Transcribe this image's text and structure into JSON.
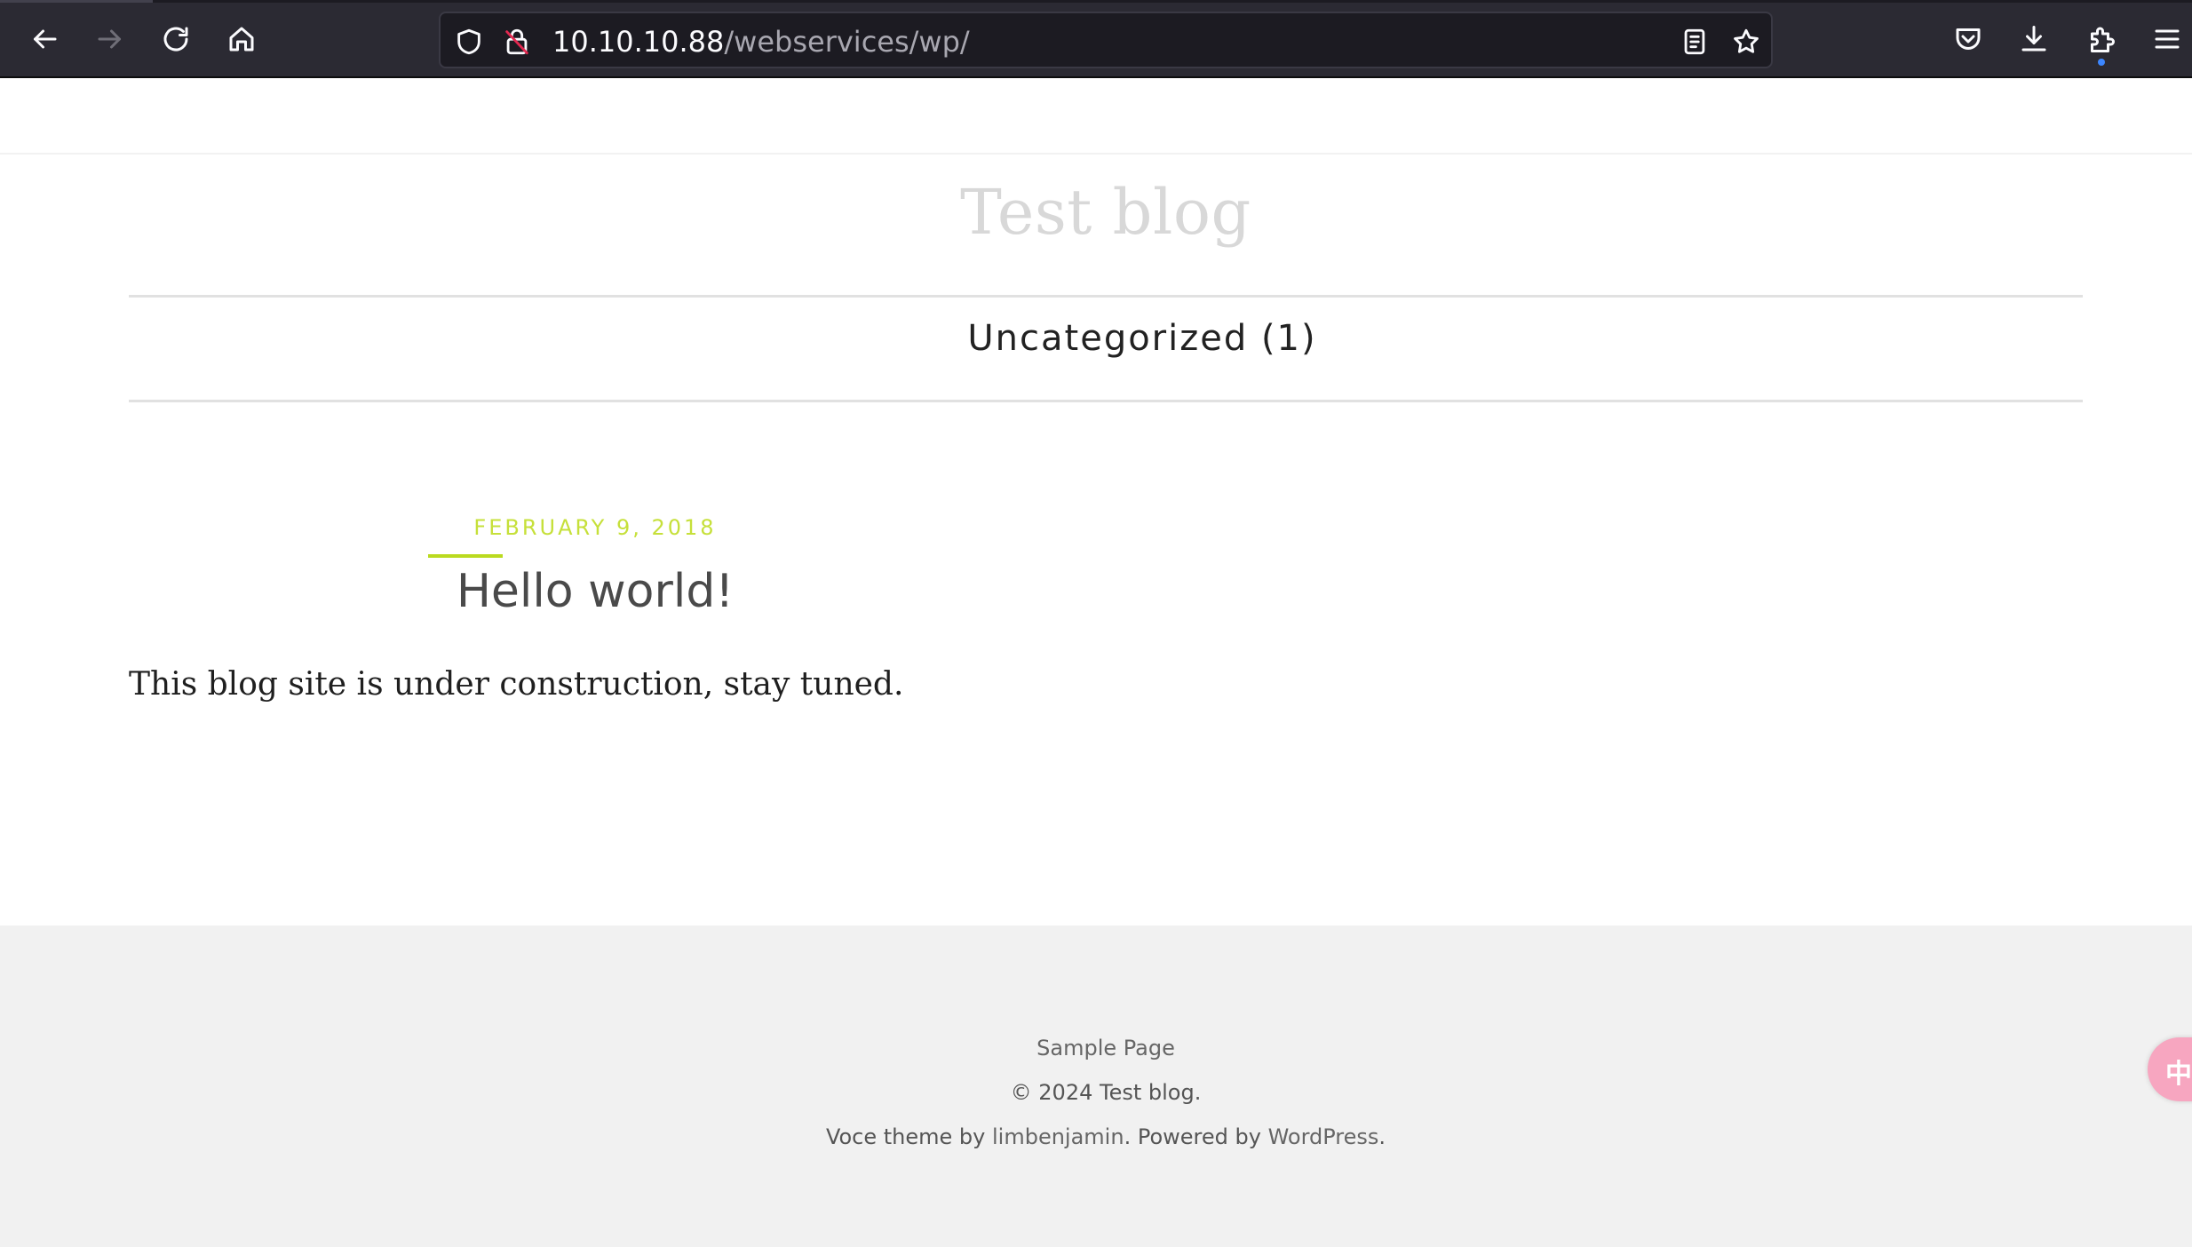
{
  "browser": {
    "url_host": "10.10.10.88",
    "url_path": "/webservices/wp/"
  },
  "site": {
    "title": "Test blog",
    "nav_item": "Uncategorized (1)"
  },
  "post": {
    "date": "FEBRUARY 9, 2018",
    "title": "Hello world!",
    "body": "This blog site is under construction, stay tuned."
  },
  "footer": {
    "sample_page": "Sample Page",
    "copyright": "© 2024 Test blog.",
    "credit_prefix": "Voce theme by ",
    "theme_author": "limbenjamin",
    "credit_middle": ". Powered by ",
    "powered_by": "WordPress",
    "credit_suffix": "."
  },
  "floating_button": {
    "label": "中A"
  },
  "colors": {
    "chrome_bg": "#2b2a33",
    "urlbar_bg": "#1c1b22",
    "accent_green": "#c6e03a",
    "footer_bg": "#f1f1f1",
    "float_pink": "#f7a6c0"
  },
  "icons": [
    "back-arrow-icon",
    "forward-arrow-icon",
    "reload-icon",
    "home-icon",
    "shield-icon",
    "insecure-lock-icon",
    "reader-view-icon",
    "bookmark-star-icon",
    "pocket-icon",
    "download-icon",
    "extensions-icon",
    "menu-icon",
    "translate-icon"
  ]
}
